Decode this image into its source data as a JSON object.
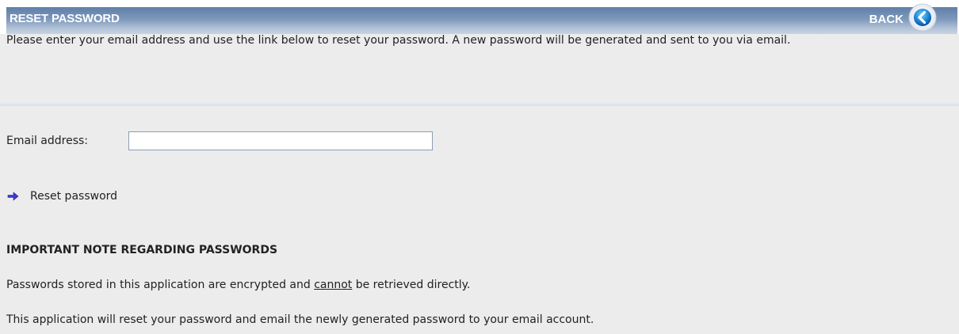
{
  "header": {
    "title": "RESET PASSWORD",
    "back_label": "BACK",
    "back_icon": "back-arrow-circle-icon"
  },
  "intro_text": "Please enter your email address and use the link below to reset your password. A new password will be generated and sent to you via email.",
  "form": {
    "email_label": "Email address:",
    "email_value": "",
    "email_placeholder": ""
  },
  "reset_link": {
    "label": "Reset password",
    "icon": "right-arrow-icon"
  },
  "note": {
    "heading": "IMPORTANT NOTE REGARDING PASSWORDS",
    "line1_before": "Passwords stored in this application are encrypted and ",
    "line1_emphasis": "cannot",
    "line1_after": " be retrieved directly.",
    "line2": "This application will reset your password and email the newly generated password to your email account."
  },
  "colors": {
    "header_top": "#5f7fa8",
    "header_bottom": "#c8d3e2",
    "background": "#ececec",
    "arrow": "#3a3acc"
  }
}
